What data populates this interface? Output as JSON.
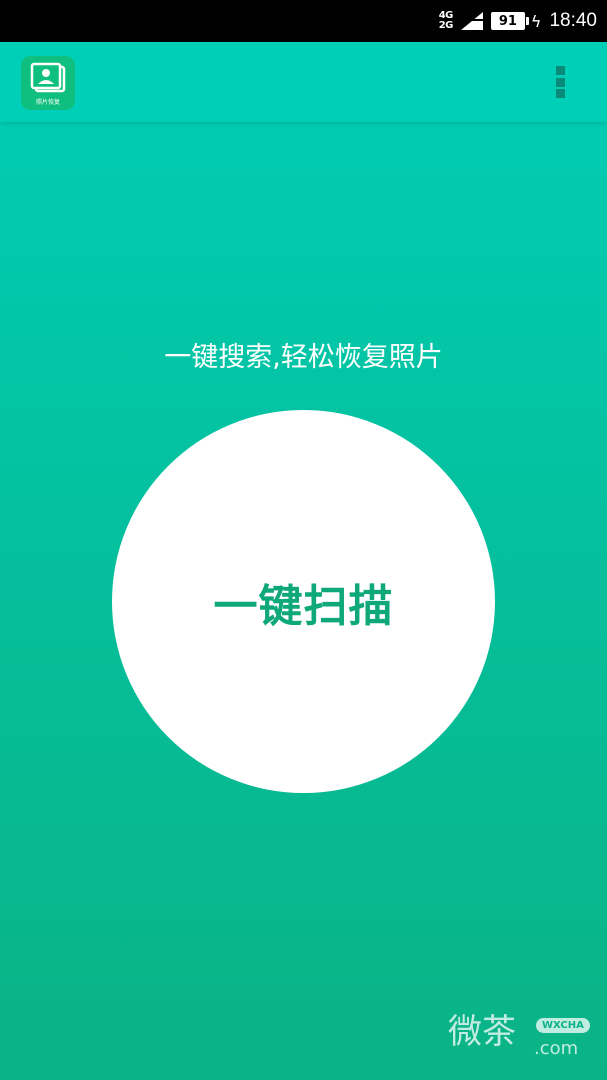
{
  "status_bar": {
    "network_label_top": "4G",
    "network_label_bottom": "2G",
    "battery_level": "91",
    "time": "18:40"
  },
  "app_bar": {
    "app_icon_label": "照片恢复"
  },
  "main": {
    "tagline": "一键搜索,轻松恢复照片",
    "scan_button_label": "一键扫描"
  },
  "watermark": {
    "characters": "微茶",
    "badge": "WXCHA",
    "domain": ".com"
  },
  "colors": {
    "gradient_top": "#00d0b8",
    "gradient_bottom": "#0ab385",
    "scan_label": "#0ea879",
    "app_icon_bg": "#0fbf7f"
  }
}
